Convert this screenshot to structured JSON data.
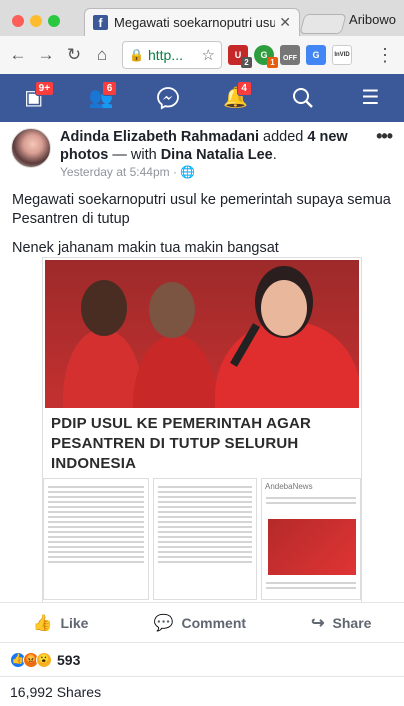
{
  "browser": {
    "tab_title": "Megawati soekarnoputri usul k",
    "profile_name": "Aribowo",
    "url_display": "http...",
    "ext_badges": [
      "2",
      "1"
    ],
    "ext_labels": [
      "OFF",
      "InVID"
    ]
  },
  "fb_nav": {
    "items": [
      {
        "icon": "news-feed-icon",
        "badge": "9+"
      },
      {
        "icon": "friends-icon",
        "badge": "6"
      },
      {
        "icon": "messenger-icon",
        "badge": ""
      },
      {
        "icon": "notifications-bell-icon",
        "badge": "4"
      },
      {
        "icon": "search-icon",
        "badge": ""
      },
      {
        "icon": "menu-icon",
        "badge": ""
      }
    ]
  },
  "post": {
    "author": "Adinda Elizabeth Rahmadani",
    "action": " added ",
    "object": "4 new photos",
    "with_text": " — with ",
    "tagged": "Dina Natalia Lee",
    "end": ".",
    "time": "Yesterday at 5:44pm · ",
    "globe": "🌐",
    "more": "•••",
    "text_lines": [
      "Megawati soekarnoputri usul ke pemerintah supaya semua Pesantren di tutup",
      "Nenek jahanam makin tua makin bangsat"
    ],
    "caption_line1": "PDIP USUL KE PEMERINTAH AGAR",
    "caption_line2": "PESANTREN DI TUTUP SELURUH INDONESIA",
    "thumb_header": "AndebaNews",
    "actions": {
      "like": "Like",
      "comment": "Comment",
      "share": "Share"
    },
    "reaction_count": "593",
    "shares": "16,992 Shares"
  },
  "colors": {
    "fb_blue": "#3b5998",
    "badge_red": "#fa3e3e",
    "url_green": "#0b8043"
  }
}
